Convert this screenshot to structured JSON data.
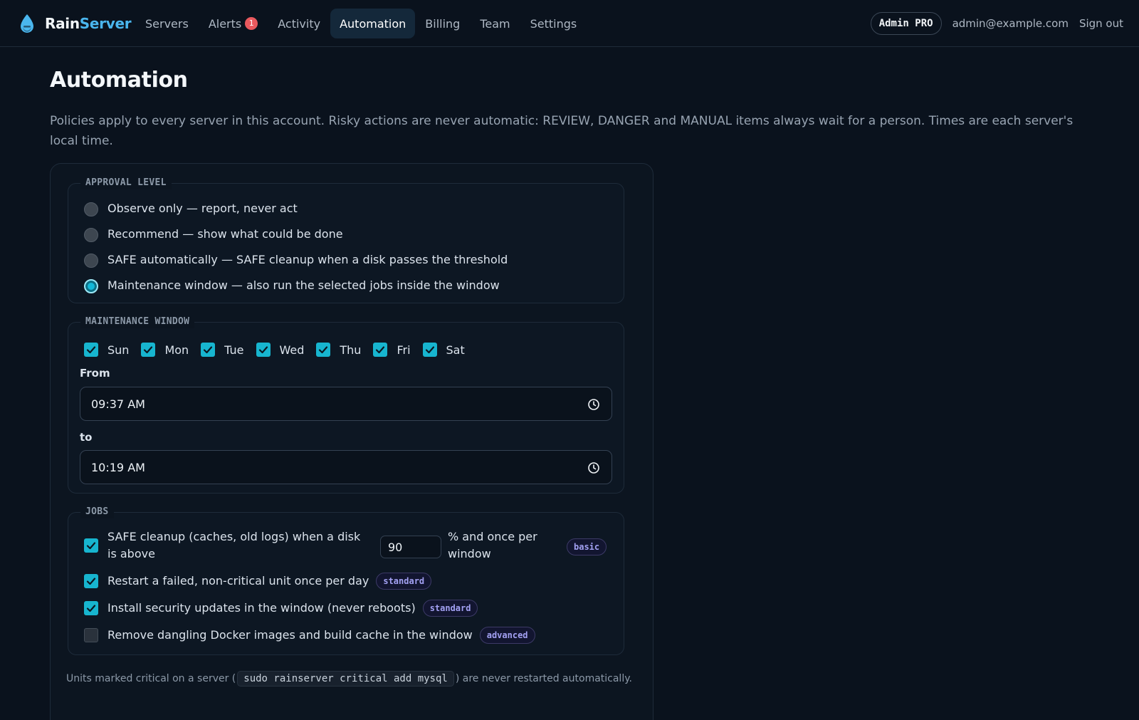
{
  "brand": {
    "name_a": "Rain",
    "name_b": "Server",
    "logo_icon": "water-drop-icon"
  },
  "nav": {
    "items": [
      {
        "label": "Servers"
      },
      {
        "label": "Alerts",
        "badge": "1"
      },
      {
        "label": "Activity"
      },
      {
        "label": "Automation",
        "active": true
      },
      {
        "label": "Billing"
      },
      {
        "label": "Team"
      },
      {
        "label": "Settings"
      }
    ]
  },
  "account": {
    "plan": "Admin PRO",
    "email": "admin@example.com",
    "signout": "Sign out"
  },
  "page": {
    "title": "Automation",
    "description": "Policies apply to every server in this account. Risky actions are never automatic: REVIEW, DANGER and MANUAL items always wait for a person. Times are each server's local time."
  },
  "approval": {
    "legend": "APPROVAL LEVEL",
    "options": [
      {
        "label": "Observe only — report, never act",
        "selected": false
      },
      {
        "label": "Recommend — show what could be done",
        "selected": false
      },
      {
        "label": "SAFE automatically — SAFE cleanup when a disk passes the threshold",
        "selected": false
      },
      {
        "label": "Maintenance window — also run the selected jobs inside the window",
        "selected": true
      }
    ]
  },
  "window": {
    "legend": "MAINTENANCE WINDOW",
    "days": [
      {
        "label": "Sun",
        "checked": true
      },
      {
        "label": "Mon",
        "checked": true
      },
      {
        "label": "Tue",
        "checked": true
      },
      {
        "label": "Wed",
        "checked": true
      },
      {
        "label": "Thu",
        "checked": true
      },
      {
        "label": "Fri",
        "checked": true
      },
      {
        "label": "Sat",
        "checked": true
      }
    ],
    "from_label": "From",
    "from_value": "09:37 AM",
    "to_label": "to",
    "to_value": "10:19 AM"
  },
  "jobs": {
    "legend": "JOBS",
    "cleanup": {
      "label_a": "SAFE cleanup (caches, old logs) when a disk is above",
      "threshold": "90",
      "label_b": "% and once per window",
      "tag": "basic",
      "checked": true
    },
    "restart": {
      "label": "Restart a failed, non-critical unit once per day",
      "tag": "standard",
      "checked": true
    },
    "security": {
      "label": "Install security updates in the window (never reboots)",
      "tag": "standard",
      "checked": true
    },
    "docker": {
      "label": "Remove dangling Docker images and build cache in the window",
      "tag": "advanced",
      "checked": false
    }
  },
  "footnote": {
    "before": "Units marked critical on a server (",
    "code": "sudo rainserver critical add mysql",
    "after": ") are never restarted automatically."
  },
  "colors": {
    "accent": "#17b5cf",
    "brand_blue": "#4ab6ee",
    "badge_red": "#e9595e",
    "tag_purple": "#a3a1f3"
  }
}
